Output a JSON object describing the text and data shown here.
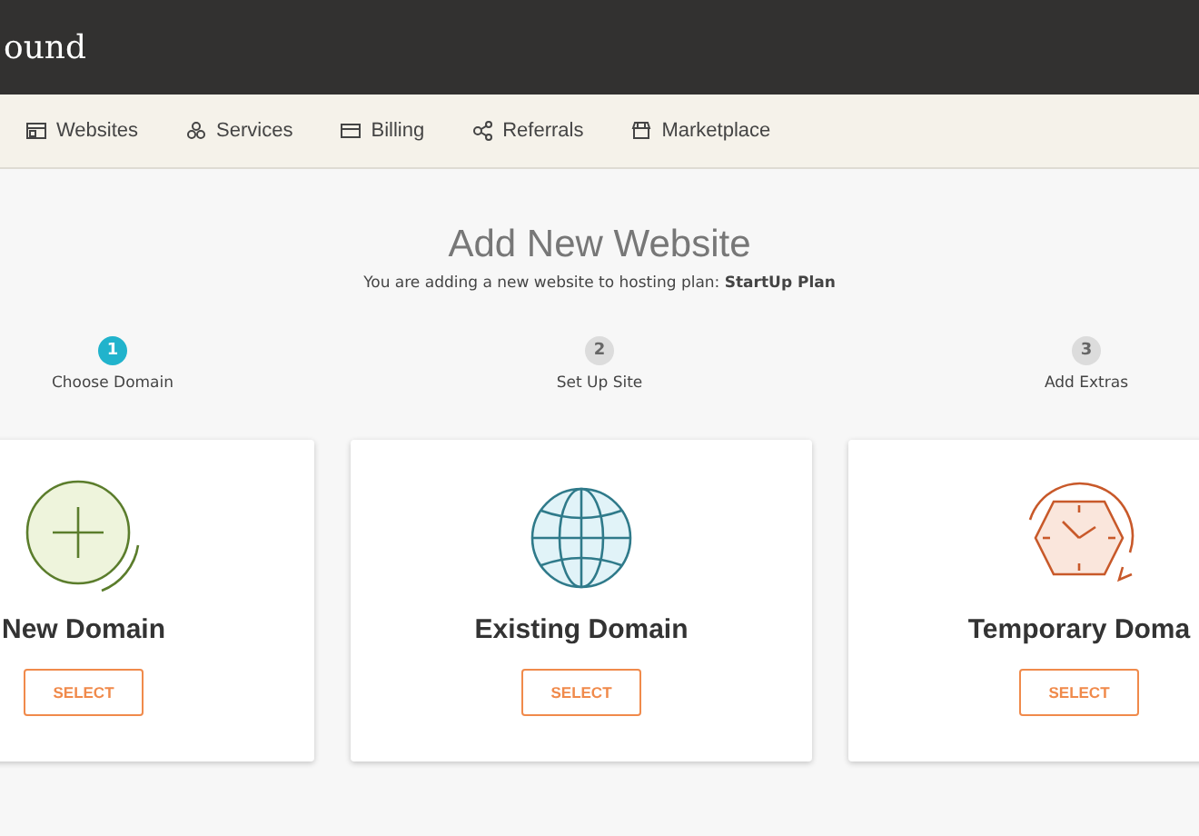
{
  "header": {
    "logo": "ound"
  },
  "nav": [
    {
      "label": "Websites",
      "kind": "websites"
    },
    {
      "label": "Services",
      "kind": "services"
    },
    {
      "label": "Billing",
      "kind": "billing"
    },
    {
      "label": "Referrals",
      "kind": "referrals"
    },
    {
      "label": "Marketplace",
      "kind": "marketplace"
    }
  ],
  "page": {
    "title": "Add New Website",
    "subtitle": "You are adding a new website to hosting plan: **StartUp Plan**"
  },
  "steps": [
    {
      "number": "1",
      "label": "Choose Domain",
      "selected": true
    },
    {
      "number": "2",
      "label": "Set Up Site",
      "selected": false
    },
    {
      "number": "3",
      "label": "Add Extras",
      "selected": false
    }
  ],
  "options": [
    {
      "kind": "new",
      "title": "New Domain",
      "button": "SELECT"
    },
    {
      "kind": "existing",
      "title": "Existing Domain",
      "button": "SELECT"
    },
    {
      "kind": "temporary",
      "title": "Temporary Doma",
      "button": "SELECT"
    }
  ]
}
